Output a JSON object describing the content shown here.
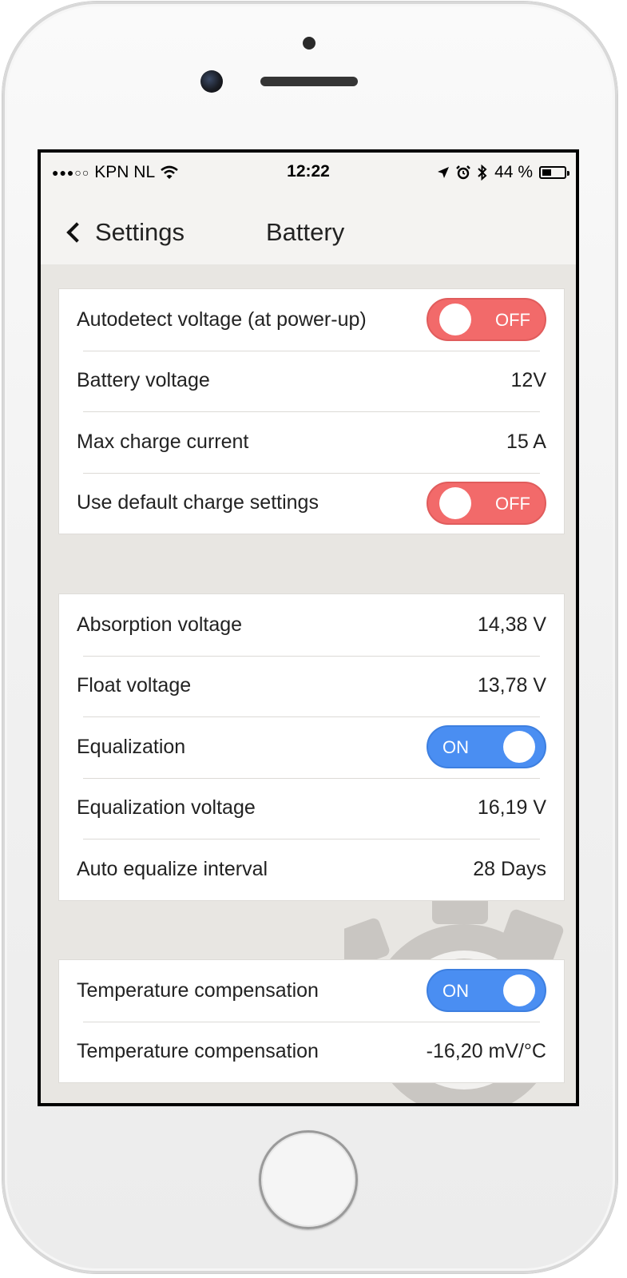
{
  "status_bar": {
    "signal": "●●●○○",
    "carrier": "KPN NL",
    "time": "12:22",
    "battery_percent": "44 %",
    "battery_level": 0.44
  },
  "nav": {
    "back_label": "Settings",
    "title": "Battery"
  },
  "sections": [
    {
      "rows": [
        {
          "label": "Autodetect voltage (at power-up)",
          "toggle": "OFF"
        },
        {
          "label": "Battery voltage",
          "value": "12V"
        },
        {
          "label": "Max charge current",
          "value": "15 A"
        },
        {
          "label": "Use default charge settings",
          "toggle": "OFF"
        }
      ]
    },
    {
      "rows": [
        {
          "label": "Absorption voltage",
          "value": "14,38 V"
        },
        {
          "label": "Float voltage",
          "value": "13,78 V"
        },
        {
          "label": "Equalization",
          "toggle": "ON"
        },
        {
          "label": "Equalization voltage",
          "value": "16,19 V"
        },
        {
          "label": "Auto equalize interval",
          "value": "28 Days"
        }
      ]
    },
    {
      "rows": [
        {
          "label": "Temperature compensation",
          "toggle": "ON"
        },
        {
          "label": "Temperature compensation",
          "value": "-16,20 mV/°C"
        }
      ]
    }
  ],
  "colors": {
    "toggle_off": "#f26a6a",
    "toggle_on": "#4a8ef2",
    "background": "#e8e6e2"
  }
}
